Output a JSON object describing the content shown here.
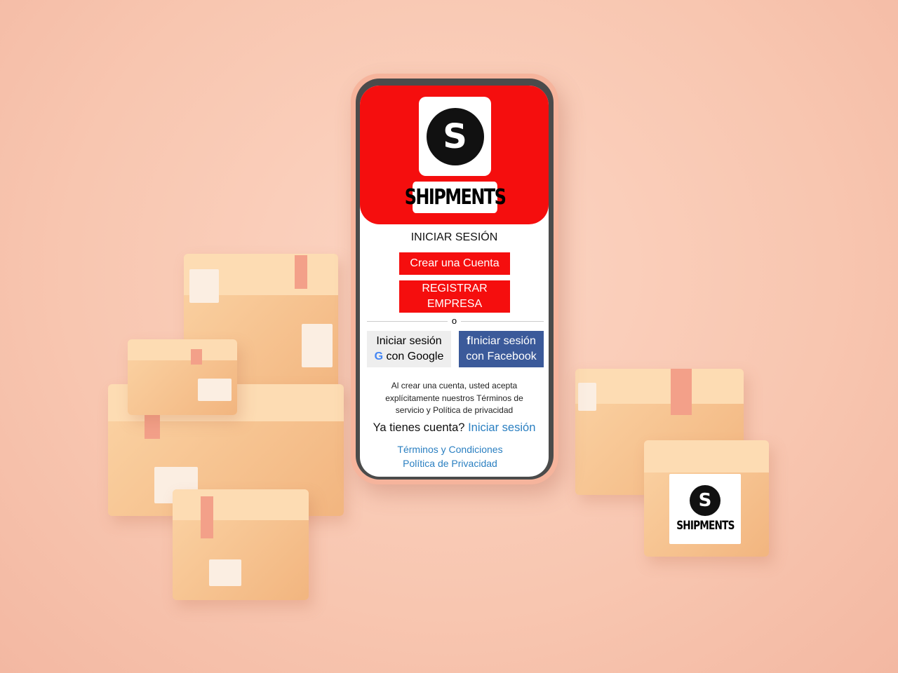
{
  "app": {
    "brand": "SHIPMENTS",
    "logo_letter": "S"
  },
  "login": {
    "title": "INICIAR SESIÓN",
    "create_account": "Crear una Cuenta",
    "register_company_line1": "REGISTRAR",
    "register_company_line2": "EMPRESA",
    "separator": "o",
    "google_line1": "Iniciar sesión",
    "google_line2": "con Google",
    "facebook_line1": "Iniciar sesión",
    "facebook_line2": "con Facebook",
    "terms_notice_1": "Al crear una cuenta, usted acepta",
    "terms_notice_2": "explícitamente nuestros Términos de",
    "terms_notice_3": "servicio y Política de privacidad",
    "have_account": "Ya tienes cuenta?",
    "sign_in_link": "Iniciar sesión",
    "terms_link": "Términos y Condiciones",
    "privacy_link": "Política de Privacidad"
  },
  "box_label": {
    "brand": "SHIPMENTS",
    "letter": "S"
  },
  "colors": {
    "primary": "#f50e0e",
    "facebook": "#3b5a9a",
    "link": "#2a7fc1",
    "background": "#f8c6b0"
  }
}
